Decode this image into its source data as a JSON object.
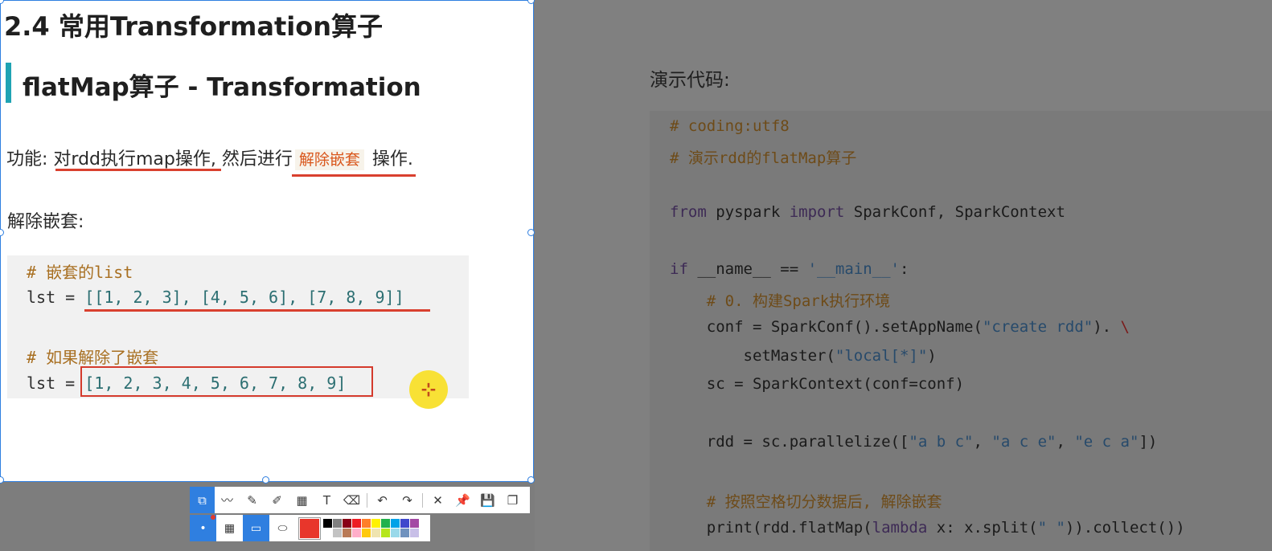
{
  "background": {
    "demo_label": "演示代码:",
    "code": {
      "l1": "# coding:utf8",
      "l2": "# 演示rdd的flatMap算子",
      "l3_kw1": "from",
      "l3_mid": " pyspark ",
      "l3_kw2": "import",
      "l3_rest": " SparkConf, SparkContext",
      "l4_kw": "if",
      "l4_mid": " __name__ == ",
      "l4_str": "'__main__'",
      "l4_end": ":",
      "l5": "    # 0. 构建Spark执行环境",
      "l6_a": "    conf = SparkConf().setAppName(",
      "l6_str": "\"create rdd\"",
      "l6_b": "). ",
      "l6_bs": "\\",
      "l7_a": "        setMaster(",
      "l7_str": "\"local[*]\"",
      "l7_b": ")",
      "l8": "    sc = SparkContext(conf=conf)",
      "l9_a": "    rdd = sc.parallelize([",
      "l9_s1": "\"a b c\"",
      "l9_c1": ", ",
      "l9_s2": "\"a c e\"",
      "l9_c2": ", ",
      "l9_s3": "\"e c a\"",
      "l9_b": "])",
      "l10": "    # 按照空格切分数据后, 解除嵌套",
      "l11_a": "    print(rdd.flatMap(",
      "l11_kw": "lambda",
      "l11_b": " x: x.split(",
      "l11_str": "\" \"",
      "l11_c": ")).collect())"
    }
  },
  "selection": {
    "section_title": "2.4 常用Transformation算子",
    "subsection_title": "flatMap算子 - Transformation",
    "func_prefix": "功能: ",
    "func_part1": "对rdd执行map操作",
    "func_part2": ", 然后进行",
    "func_highlight": "解除嵌套",
    "func_part3": " 操作.",
    "nest_label": "解除嵌套:",
    "code": {
      "c1": "# 嵌套的list",
      "c2_pre": "lst = ",
      "c2_val": "[[1, 2, 3], [4, 5, 6], [7, 8, 9]]",
      "c3": "# 如果解除了嵌套",
      "c4_pre": "lst = ",
      "c4_val": "[1, 2, 3, 4, 5, 6, 7, 8, 9]"
    }
  },
  "cursor_glyph": "⊹",
  "toolbar": {
    "icons": [
      "select-region-icon",
      "polyline-icon",
      "pencil-icon",
      "marker-icon",
      "mosaic-icon",
      "text-icon",
      "eraser-icon",
      "undo-icon",
      "redo-icon",
      "close-icon",
      "pin-icon",
      "save-icon",
      "copy-icon"
    ],
    "glyphs": {
      "select": "⧉",
      "polyline": "〰",
      "pencil": "✎",
      "marker": "✐",
      "mosaic": "▦",
      "text": "T",
      "eraser": "⌫",
      "undo": "↶",
      "redo": "↷",
      "close": "✕",
      "pin": "📌",
      "save": "💾",
      "copy": "❐"
    },
    "row2_glyphs": {
      "dot": "•",
      "fill": "▦",
      "rect": "▭",
      "ellipse": "⬭"
    },
    "current_color": "#e8362b",
    "palette": [
      "#000000",
      "#7f7f7f",
      "#880015",
      "#ed1c24",
      "#ff7f27",
      "#fff200",
      "#22b14c",
      "#00a2e8",
      "#3f48cc",
      "#a349a4",
      "#ffffff",
      "#c3c3c3",
      "#b97a57",
      "#ffaec9",
      "#ffc90e",
      "#efe4b0",
      "#b5e61d",
      "#99d9ea",
      "#7092be",
      "#c8bfe7"
    ]
  }
}
